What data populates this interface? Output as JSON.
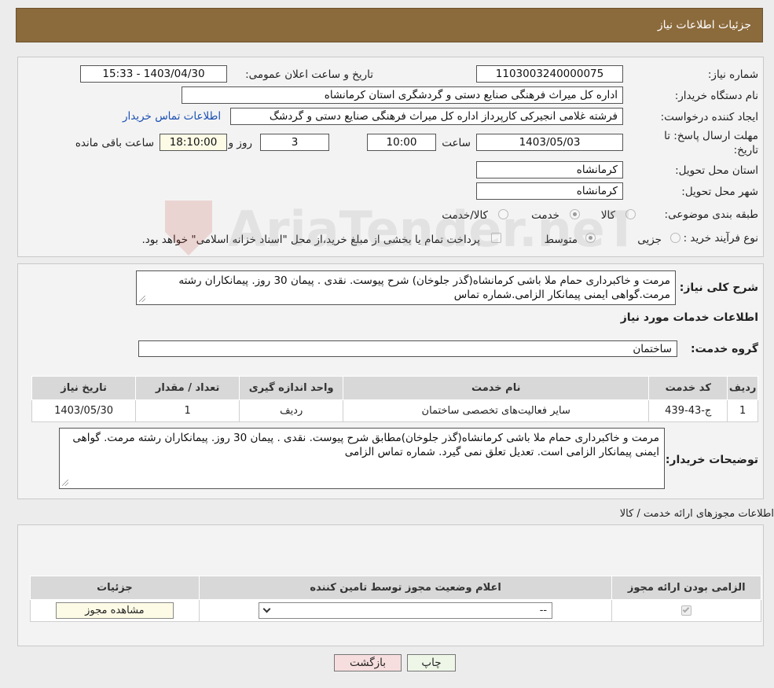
{
  "header": {
    "title": "جزئیات اطلاعات نیاز"
  },
  "fields": {
    "need_number_label": "شماره نیاز:",
    "need_number": "1103003240000075",
    "announce_label": "تاریخ و ساعت اعلان عمومی:",
    "announce_value": "1403/04/30 - 15:33",
    "buyer_org_label": "نام دستگاه خریدار:",
    "buyer_org": "اداره کل میراث فرهنگی  صنایع دستی و گردشگری استان کرمانشاه",
    "creator_label": "ایجاد کننده درخواست:",
    "creator": "فرشته غلامی انجیرکی کارپرداز اداره کل میراث فرهنگی  صنایع دستی و گردشگ",
    "contact_link": "اطلاعات تماس خریدار",
    "deadline_label": "مهلت ارسال پاسخ: تا تاریخ:",
    "deadline_date": "1403/05/03",
    "time_label": "ساعت",
    "deadline_time": "10:00",
    "days_value": "3",
    "days_label": "روز و",
    "remaining_time": "18:10:00",
    "remaining_label": "ساعت باقی مانده",
    "province_label": "استان محل تحویل:",
    "province": "کرمانشاه",
    "city_label": "شهر محل تحویل:",
    "city": "کرمانشاه",
    "category_label": "طبقه بندی موضوعی:",
    "category_options": [
      "کالا",
      "خدمت",
      "کالا/خدمت"
    ],
    "process_label": "نوع فرآیند خرید :",
    "process_options": [
      "جزیی",
      "متوسط"
    ],
    "payment_note": "پرداخت تمام یا بخشی از مبلغ خرید،از محل \"اسناد خزانه اسلامی\" خواهد بود."
  },
  "summary": {
    "label": "شرح کلی نیاز:",
    "text": "مرمت و خاکبرداری حمام ملا باشی کرمانشاه(گذر جلوخان) شرح پیوست. نقدی . پیمان 30 روز. پیمانکاران رشته مرمت.گواهی ایمنی پیمانکار الزامی.شماره تماس"
  },
  "services": {
    "title": "اطلاعات خدمات مورد نیاز",
    "group_label": "گروه خدمت:",
    "group_value": "ساختمان",
    "columns": [
      "ردیف",
      "کد خدمت",
      "نام خدمت",
      "واحد اندازه گیری",
      "تعداد / مقدار",
      "تاریخ نیاز"
    ],
    "rows": [
      [
        "1",
        "ج-43-439",
        "سایر فعالیت‌های تخصصی ساختمان",
        "ردیف",
        "1",
        "1403/05/30"
      ]
    ]
  },
  "buyer_notes": {
    "label": "توضیحات خریدار:",
    "text": "مرمت و خاکبرداری حمام ملا باشی کرمانشاه(گذر جلوخان)مطابق شرح پیوست. نقدی . پیمان 30 روز. پیمانکاران رشته مرمت. گواهی ایمنی پیمانکار الزامی است. تعدیل تعلق نمی گیرد. شماره تماس الزامی"
  },
  "permits": {
    "title": "اطلاعات مجوزهای ارائه خدمت / کالا",
    "columns": [
      "الزامی بودن ارائه مجوز",
      "اعلام وضعیت مجوز توسط تامین کننده",
      "جزئیات"
    ],
    "select_value": "--",
    "view_button": "مشاهده مجوز"
  },
  "actions": {
    "print": "چاپ",
    "back": "بازگشت"
  },
  "watermark": {
    "text": "AriaTender.neT"
  }
}
